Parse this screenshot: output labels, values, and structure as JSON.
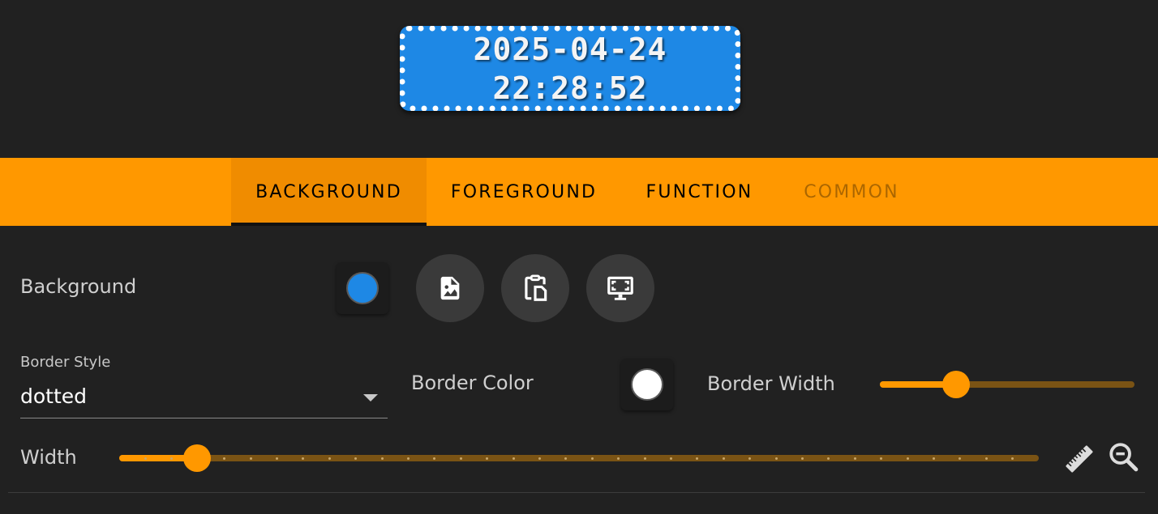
{
  "preview": {
    "date": "2025-04-24",
    "time": "22:28:52",
    "background_color": "#1e88e5",
    "border_style": "dotted",
    "border_color": "#ffffff"
  },
  "tabs": [
    {
      "label": "BACKGROUND",
      "active": true
    },
    {
      "label": "FOREGROUND",
      "active": false
    },
    {
      "label": "FUNCTION",
      "active": false
    },
    {
      "label": "COMMON",
      "active": false,
      "disabled": true
    }
  ],
  "tabbar": {
    "color": "#ff9800",
    "active_color": "#f08c00"
  },
  "background_row": {
    "label": "Background",
    "color": "#1e88e5",
    "buttons": [
      "image-icon",
      "clipboard-file-icon",
      "monitor-fullscreen-icon"
    ]
  },
  "border_style": {
    "label": "Border Style",
    "value": "dotted"
  },
  "border_color": {
    "label": "Border Color",
    "color": "#ffffff"
  },
  "border_width": {
    "label": "Border Width",
    "level": 0.3
  },
  "width": {
    "label": "Width",
    "level": 0.085,
    "steps": 35
  },
  "accent": "#ff9800",
  "tools": [
    "ruler-icon",
    "zoom-out-icon"
  ]
}
